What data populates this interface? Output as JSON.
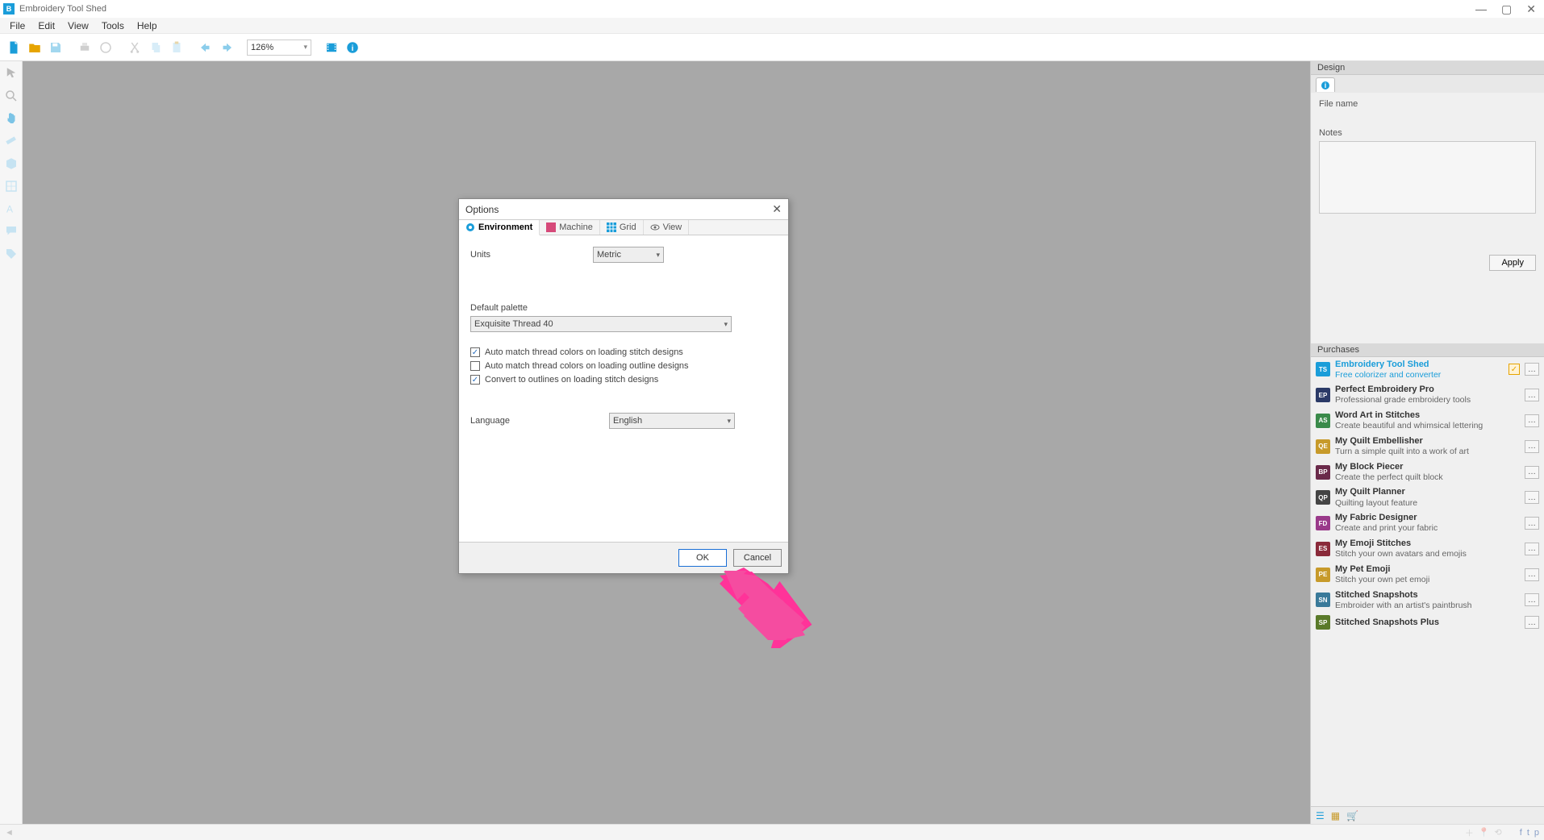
{
  "app": {
    "title": "Embroidery Tool Shed"
  },
  "menu": {
    "items": [
      "File",
      "Edit",
      "View",
      "Tools",
      "Help"
    ]
  },
  "toolbar": {
    "zoom": "126%"
  },
  "design_panel": {
    "header": "Design",
    "filename_label": "File name",
    "notes_label": "Notes",
    "apply": "Apply"
  },
  "purchases_panel": {
    "header": "Purchases",
    "items": [
      {
        "code": "TS",
        "color": "#1a9dd9",
        "title": "Embroidery Tool Shed",
        "desc": "Free colorizer and converter",
        "active": true
      },
      {
        "code": "EP",
        "color": "#2b3a67",
        "title": "Perfect Embroidery Pro",
        "desc": "Professional grade embroidery tools"
      },
      {
        "code": "AS",
        "color": "#3a8a4a",
        "title": "Word Art in Stitches",
        "desc": "Create beautiful and whimsical lettering"
      },
      {
        "code": "QE",
        "color": "#c79a2a",
        "title": "My Quilt Embellisher",
        "desc": "Turn a simple quilt into a work of art"
      },
      {
        "code": "BP",
        "color": "#6a2a4a",
        "title": "My Block Piecer",
        "desc": "Create the perfect quilt block"
      },
      {
        "code": "QP",
        "color": "#444",
        "title": "My Quilt Planner",
        "desc": "Quilting layout feature"
      },
      {
        "code": "FD",
        "color": "#9a3a8a",
        "title": "My Fabric Designer",
        "desc": "Create and print your fabric"
      },
      {
        "code": "ES",
        "color": "#8a2a3a",
        "title": "My Emoji Stitches",
        "desc": "Stitch your own avatars and emojis"
      },
      {
        "code": "PE",
        "color": "#c79a2a",
        "title": "My Pet Emoji",
        "desc": "Stitch your own pet emoji"
      },
      {
        "code": "SN",
        "color": "#3a7a9a",
        "title": "Stitched Snapshots",
        "desc": "Embroider with an artist's paintbrush"
      },
      {
        "code": "SP",
        "color": "#5a7a2a",
        "title": "Stitched Snapshots Plus",
        "desc": ""
      }
    ]
  },
  "dialog": {
    "title": "Options",
    "tabs": [
      "Environment",
      "Machine",
      "Grid",
      "View"
    ],
    "units_label": "Units",
    "units_value": "Metric",
    "palette_label": "Default palette",
    "palette_value": "Exquisite Thread 40",
    "chk1": {
      "checked": true,
      "label": "Auto match thread colors on loading stitch designs"
    },
    "chk2": {
      "checked": false,
      "label": "Auto match thread colors on loading outline designs"
    },
    "chk3": {
      "checked": true,
      "label": "Convert to outlines on loading stitch designs"
    },
    "language_label": "Language",
    "language_value": "English",
    "ok": "OK",
    "cancel": "Cancel"
  }
}
